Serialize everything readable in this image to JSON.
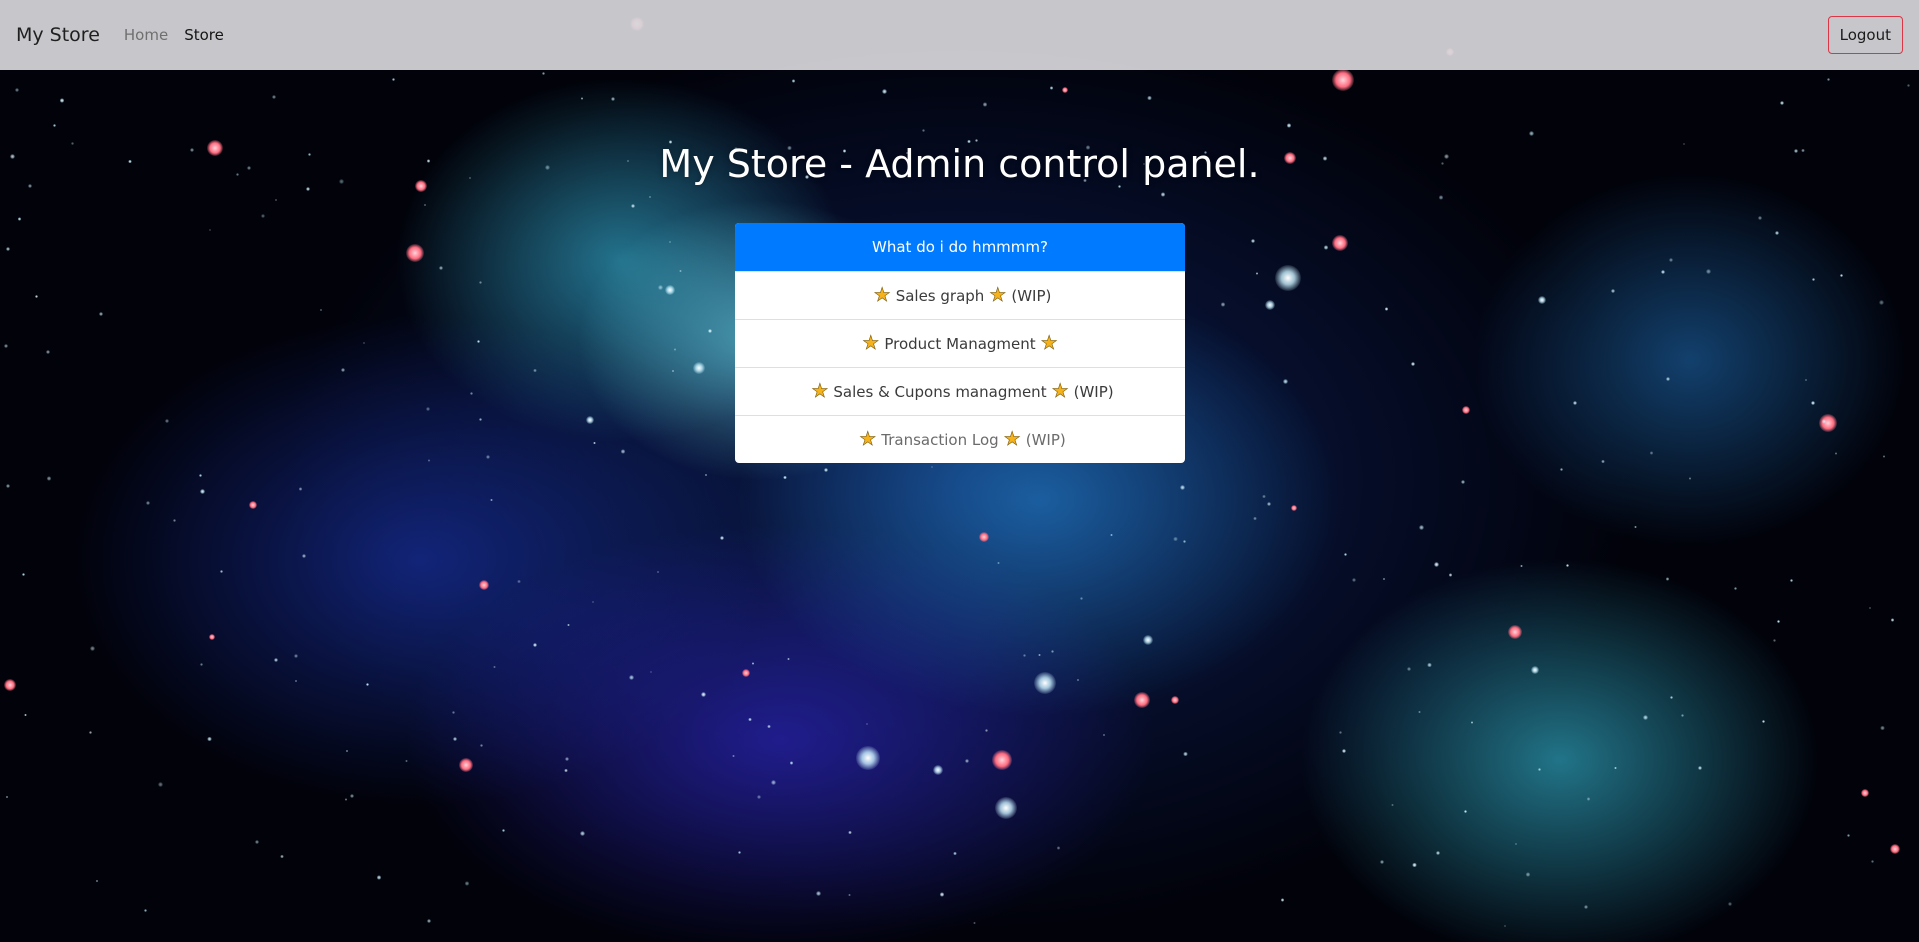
{
  "navbar": {
    "brand": "My Store",
    "links": [
      {
        "label": "Home"
      },
      {
        "label": "Store"
      }
    ],
    "logout_label": "Logout",
    "logout_border_color": "#dc3545"
  },
  "page": {
    "title": "My Store - Admin control panel."
  },
  "panel": {
    "header": "What do i do hmmmm?",
    "header_color": "#007bff",
    "items": [
      {
        "label": "Sales graph",
        "suffix": "(WIP)",
        "icon": "star-icon"
      },
      {
        "label": "Product Managment",
        "suffix": "",
        "icon": "star-icon"
      },
      {
        "label": "Sales & Cupons managment",
        "suffix": "(WIP)",
        "icon": "star-icon"
      },
      {
        "label": "Transaction Log",
        "suffix": "(WIP)",
        "icon": "star-icon"
      }
    ]
  }
}
